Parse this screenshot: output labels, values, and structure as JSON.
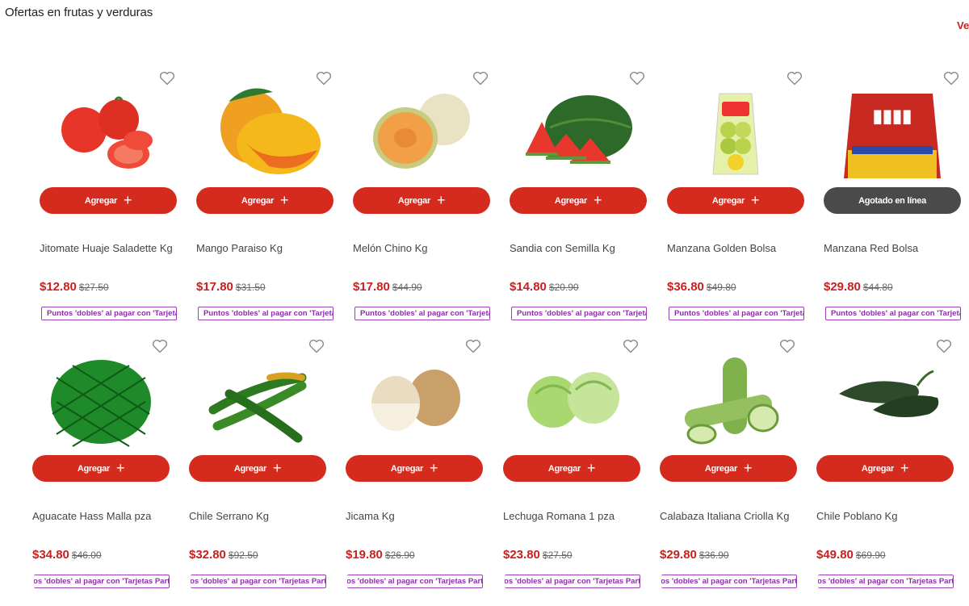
{
  "section": {
    "title": "Ofertas en frutas y verduras",
    "see_all": "Ve"
  },
  "labels": {
    "add": "Agregar",
    "sold_out": "Agotado en línea",
    "promo": "Puntos 'dobles' al pagar con 'Tarjetas Participantes'"
  },
  "colors": {
    "accent": "#d52b1e",
    "price": "#c8201e",
    "promo": "#8a2fa8",
    "sold_out": "#4a4a4a"
  },
  "products": [
    {
      "name": "Jitomate Huaje Saladette Kg",
      "price": "$12.80",
      "old_price": "$27.50",
      "icon": "tomato-image",
      "button": "Agregar",
      "sold_out": false
    },
    {
      "name": "Mango Paraiso Kg",
      "price": "$17.80",
      "old_price": "$31.50",
      "icon": "mango-image",
      "button": "Agregar",
      "sold_out": false
    },
    {
      "name": "Melón Chino Kg",
      "price": "$17.80",
      "old_price": "$44.90",
      "icon": "melon-image",
      "button": "Agregar",
      "sold_out": false
    },
    {
      "name": "Sandia con Semilla Kg",
      "price": "$14.80",
      "old_price": "$20.90",
      "icon": "watermelon-image",
      "button": "Agregar",
      "sold_out": false
    },
    {
      "name": "Manzana Golden Bolsa",
      "price": "$36.80",
      "old_price": "$49.80",
      "icon": "apple-bag-image",
      "button": "Agregar",
      "sold_out": false
    },
    {
      "name": "Manzana Red Bolsa",
      "price": "$29.80",
      "old_price": "$44.80",
      "icon": "red-apple-bag-image",
      "button": "Agotado en línea",
      "sold_out": true
    },
    {
      "name": "Aguacate Hass Malla pza",
      "price": "$34.80",
      "old_price": "$46.00",
      "icon": "avocado-image",
      "button": "Agregar",
      "sold_out": false
    },
    {
      "name": "Chile Serrano Kg",
      "price": "$32.80",
      "old_price": "$92.50",
      "icon": "chili-image",
      "button": "Agregar",
      "sold_out": false
    },
    {
      "name": "Jicama Kg",
      "price": "$19.80",
      "old_price": "$26.90",
      "icon": "jicama-image",
      "button": "Agregar",
      "sold_out": false
    },
    {
      "name": "Lechuga Romana 1 pza",
      "price": "$23.80",
      "old_price": "$27.50",
      "icon": "lettuce-image",
      "button": "Agregar",
      "sold_out": false
    },
    {
      "name": "Calabaza Italiana Criolla Kg",
      "price": "$29.80",
      "old_price": "$36.90",
      "icon": "zucchini-image",
      "button": "Agregar",
      "sold_out": false
    },
    {
      "name": "Chile Poblano Kg",
      "price": "$49.80",
      "old_price": "$69.90",
      "icon": "poblano-image",
      "button": "Agregar",
      "sold_out": false
    }
  ]
}
